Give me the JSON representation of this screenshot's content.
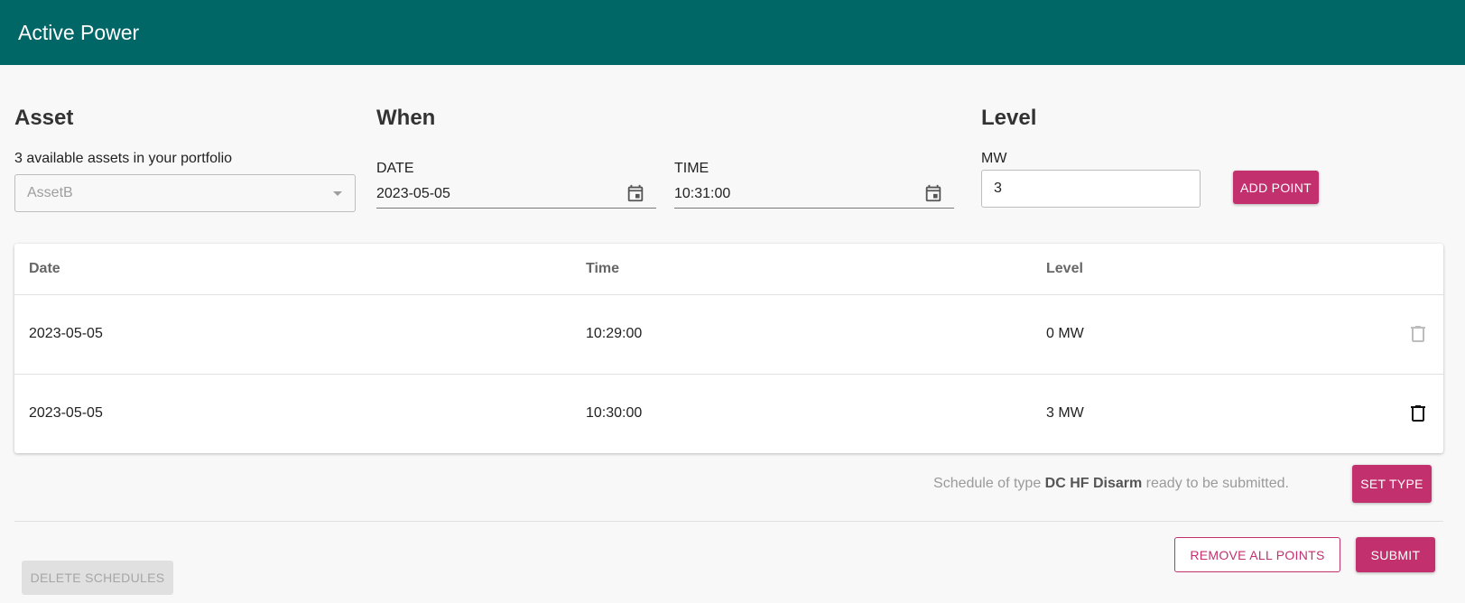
{
  "app": {
    "title": "Active Power"
  },
  "asset": {
    "heading": "Asset",
    "caption": "3 available assets in your portfolio",
    "selected": "AssetB"
  },
  "when": {
    "heading": "When",
    "date_label": "DATE",
    "date_value": "2023-05-05",
    "time_label": "TIME",
    "time_value": "10:31:00"
  },
  "level": {
    "heading": "Level",
    "unit_label": "MW",
    "value": "3",
    "add_button": "ADD POINT"
  },
  "table": {
    "headers": {
      "date": "Date",
      "time": "Time",
      "level": "Level"
    },
    "rows": [
      {
        "date": "2023-05-05",
        "time": "10:29:00",
        "level": "0 MW",
        "delete_enabled": false
      },
      {
        "date": "2023-05-05",
        "time": "10:30:00",
        "level": "3 MW",
        "delete_enabled": true
      }
    ]
  },
  "status": {
    "prefix": "Schedule of type ",
    "type": "DC HF Disarm",
    "suffix": " ready to be submitted.",
    "set_type_button": "SET TYPE"
  },
  "footer": {
    "remove_all_button": "REMOVE ALL POINTS",
    "submit_button": "SUBMIT",
    "delete_schedules_button": "DELETE SCHEDULES"
  },
  "colors": {
    "appbar": "#006666",
    "accent": "#c2306e"
  }
}
